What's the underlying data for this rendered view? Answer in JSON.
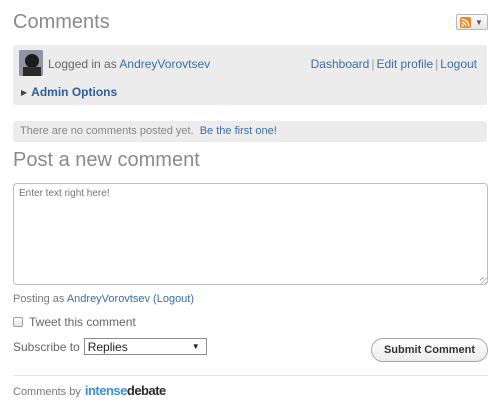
{
  "header": {
    "title": "Comments",
    "rss_icon": "rss-feed-icon",
    "dropdown_icon": "caret-down-icon"
  },
  "login": {
    "prefix": "Logged in as",
    "username": "AndreyVorovtsev",
    "links": {
      "dashboard": "Dashboard",
      "edit_profile": "Edit profile",
      "logout": "Logout"
    },
    "separator": "|",
    "admin_options": "Admin Options"
  },
  "notice": {
    "text": "There are no comments posted yet.",
    "link": "Be the first one!"
  },
  "form": {
    "title": "Post a new comment",
    "placeholder": "Enter text right here!",
    "posting_as_prefix": "Posting as",
    "posting_as_user": "AndreyVorovtsev",
    "logout_link": "(Logout)",
    "tweet_label": "Tweet this comment",
    "subscribe_label": "Subscribe to",
    "subscribe_value": "Replies",
    "submit_label": "Submit Comment"
  },
  "footer": {
    "prefix": "Comments by",
    "brand_part1": "intense",
    "brand_part2": "debate"
  },
  "colors": {
    "link": "#3a6ea5",
    "panel_bg": "#ececec",
    "heading": "#8a8a8a",
    "rss_orange": "#f08a24",
    "brand_blue": "#3a8fd6"
  }
}
